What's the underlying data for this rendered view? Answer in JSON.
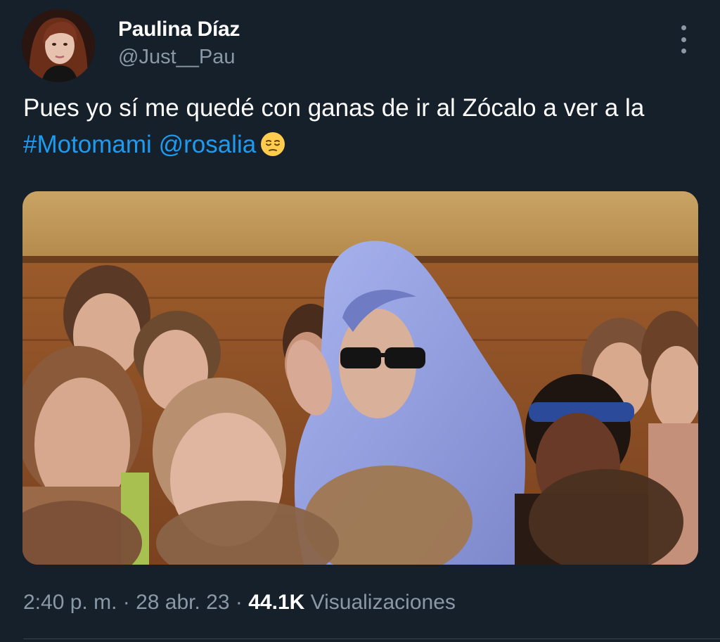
{
  "author": {
    "display_name": "Paulina Díaz",
    "handle": "@Just__Pau"
  },
  "more_icon": "more-vertical-icon",
  "tweet": {
    "text_line": "Pues yo sí me quedé con ganas de ir al Zócalo a ver a la",
    "hashtag": "#Motomami",
    "mention": "@rosalia",
    "emoji": "pensive-face-emoji"
  },
  "media": {
    "kind": "photo"
  },
  "meta": {
    "time": "2:40 p. m.",
    "separator": "·",
    "date": "28 abr. 23",
    "views_count": "44.1K",
    "views_label": "Visualizaciones"
  },
  "colors": {
    "background": "#15202b",
    "text": "#ffffff",
    "secondary": "#8b98a5",
    "link": "#1d9bf0"
  }
}
